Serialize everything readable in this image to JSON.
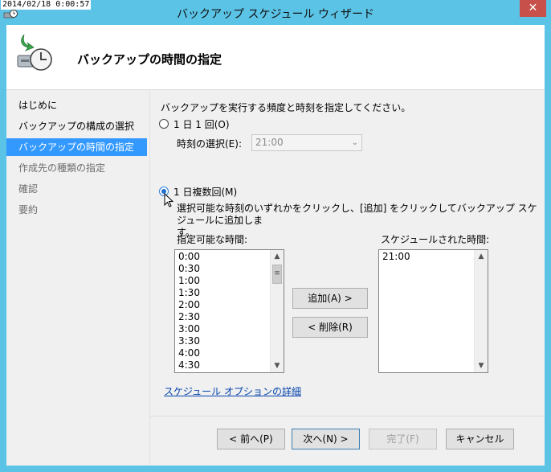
{
  "timestamp": "2014/02/18 0:00:57",
  "window": {
    "title": "バックアップ スケジュール ウィザード",
    "close_label": "✕"
  },
  "header": {
    "title": "バックアップの時間の指定"
  },
  "nav": {
    "items": [
      {
        "label": "はじめに",
        "state": "normal"
      },
      {
        "label": "バックアップの構成の選択",
        "state": "normal"
      },
      {
        "label": "バックアップの時間の指定",
        "state": "active"
      },
      {
        "label": "作成先の種類の指定",
        "state": "disabled"
      },
      {
        "label": "確認",
        "state": "disabled"
      },
      {
        "label": "要約",
        "state": "disabled"
      }
    ]
  },
  "main": {
    "instruction": "バックアップを実行する頻度と時刻を指定してください。",
    "once": {
      "radio_label": "1 日 1 回(O)",
      "time_label": "時刻の選択(E):",
      "time_value": "21:00"
    },
    "multiple": {
      "radio_label": "1 日複数回(M)",
      "description_line1": "選択可能な時刻のいずれかをクリックし、[追加] をクリックしてバックアップ スケジュールに追加しま",
      "description_line2": "す。"
    },
    "available": {
      "label": "指定可能な時間:",
      "items": [
        "0:00",
        "0:30",
        "1:00",
        "1:30",
        "2:00",
        "2:30",
        "3:00",
        "3:30",
        "4:00",
        "4:30"
      ]
    },
    "scheduled": {
      "label": "スケジュールされた時間:",
      "items": [
        "21:00"
      ]
    },
    "add_button": "追加(A) >",
    "remove_button": "< 削除(R)",
    "options_link": "スケジュール オプションの詳細"
  },
  "footer": {
    "prev_button": "< 前へ(P)",
    "next_button": "次へ(N) >",
    "finish_button": "完了(F)",
    "cancel_button": "キャンセル"
  }
}
